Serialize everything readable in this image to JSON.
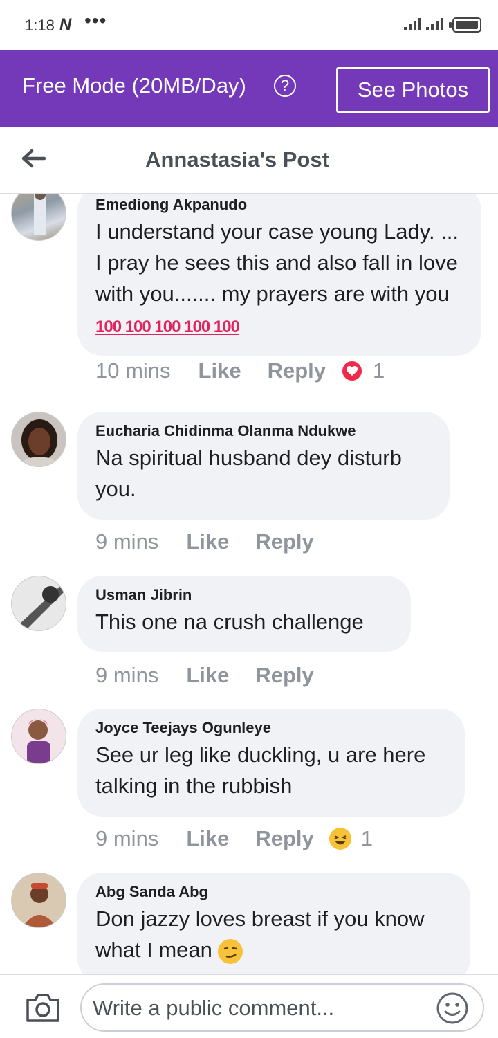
{
  "status_bar": {
    "time": "1:18",
    "carrier_glyph": "N",
    "more": "•••",
    "icons": [
      "signal-icon",
      "signal-icon",
      "battery-icon"
    ]
  },
  "banner": {
    "mode_text": "Free Mode (20MB/Day)",
    "help_symbol": "?",
    "see_photos_label": "See Photos",
    "color": "#7339b8"
  },
  "header": {
    "title": "Annastasia's Post",
    "back_icon": "back-arrow-icon"
  },
  "comments": [
    {
      "author": "Emediong Akpanudo",
      "text": "I understand your case young Lady. ... I pray he sees this and also fall in love with you....... my prayers are with you ",
      "emoji": "100 100 100 100 100",
      "time": "10 mins",
      "like": "Like",
      "reply": "Reply",
      "reaction": "love",
      "reaction_count": "1"
    },
    {
      "author": "Eucharia Chidinma Olanma Ndukwe",
      "text": "Na spiritual husband dey disturb you.",
      "time": "9 mins",
      "like": "Like",
      "reply": "Reply"
    },
    {
      "author": "Usman Jibrin",
      "text": "This one na crush challenge",
      "time": "9 mins",
      "like": "Like",
      "reply": "Reply"
    },
    {
      "author": "Joyce Teejays Ogunleye",
      "text": "See ur leg like duckling, u are here talking in the rubbish",
      "time": "9 mins",
      "like": "Like",
      "reply": "Reply",
      "reaction": "haha",
      "reaction_count": "1"
    },
    {
      "author": "Abg Sanda Abg",
      "text": "Don jazzy loves breast if you know what I mean ",
      "emoji": "smirk"
    }
  ],
  "compose": {
    "placeholder": "Write a public comment...",
    "camera_icon": "camera-icon",
    "emoji_icon": "smiley-icon"
  }
}
